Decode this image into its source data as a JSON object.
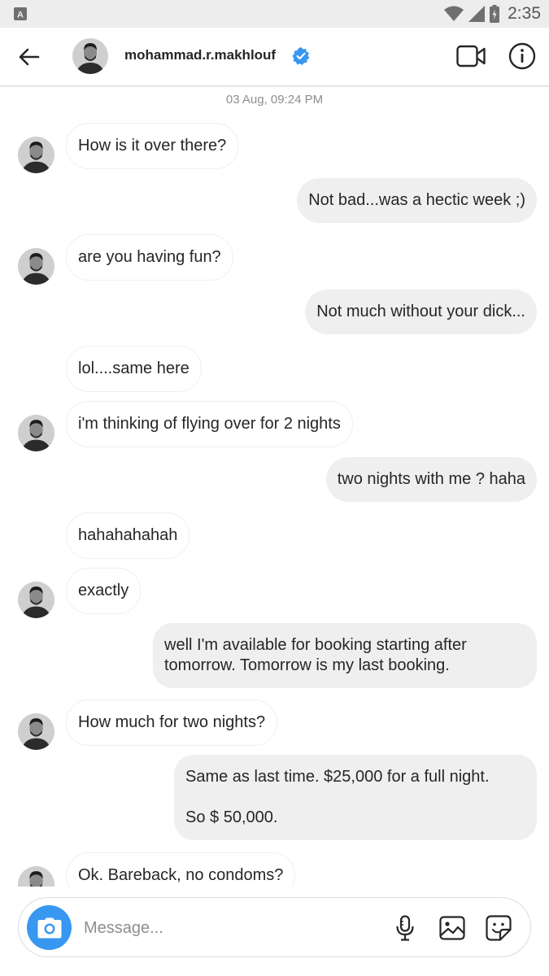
{
  "status_bar": {
    "time": "2:35",
    "icons": [
      "app-notification-icon",
      "wifi-icon",
      "signal-icon",
      "battery-icon"
    ]
  },
  "header": {
    "username": "mohammad.r.makhlouf",
    "verified": true,
    "icons": [
      "back-arrow-icon",
      "verified-badge-icon",
      "video-call-icon",
      "info-icon"
    ]
  },
  "thread": {
    "timestamp": "03 Aug, 09:24 PM",
    "messages": [
      {
        "from": "them",
        "text": "How is it over there?",
        "avatar": true
      },
      {
        "from": "me",
        "text": "Not bad...was a hectic week ;)"
      },
      {
        "from": "them",
        "text": "are you having fun?",
        "avatar": true
      },
      {
        "from": "me",
        "text": "Not much without your dick..."
      },
      {
        "from": "them",
        "text": "lol....same here",
        "avatar": false
      },
      {
        "from": "them",
        "text": "i'm thinking of flying over for 2 nights",
        "avatar": true
      },
      {
        "from": "me",
        "text": "two nights with me ? haha"
      },
      {
        "from": "them",
        "text": "hahahahahah",
        "avatar": false
      },
      {
        "from": "them",
        "text": "exactly",
        "avatar": true
      },
      {
        "from": "me",
        "text_lines": [
          "well I'm available for booking starting after",
          "tomorrow. Tomorrow is my last booking."
        ]
      },
      {
        "from": "them",
        "text": "How much for two nights?",
        "avatar": true
      },
      {
        "from": "me",
        "text_lines": [
          "Same as last time. $25,000 for a full night.",
          "",
          "So $ 50,000."
        ]
      },
      {
        "from": "them",
        "text": "Ok. Bareback, no condoms?",
        "avatar": true
      }
    ]
  },
  "composer": {
    "placeholder": "Message...",
    "icons": [
      "camera-icon",
      "microphone-icon",
      "gallery-icon",
      "sticker-icon"
    ]
  },
  "colors": {
    "accent_blue": "#3897f0",
    "verified_blue": "#3897f0",
    "outgoing_bubble": "#efefef",
    "incoming_border": "#efefef",
    "status_bar_bg": "#ededed"
  }
}
